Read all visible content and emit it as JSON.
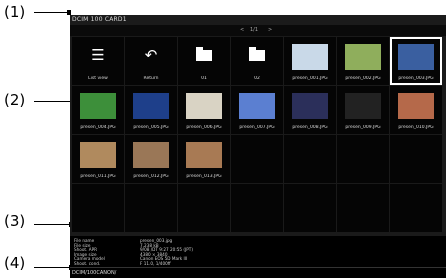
{
  "callouts": [
    "(1)",
    "(2)",
    "(3)",
    "(4)"
  ],
  "topbar": {
    "path": "DCIM  100  CARD1",
    "pager": {
      "prev": "<",
      "page": "1/1",
      "next": ">"
    }
  },
  "grid": {
    "items": [
      {
        "kind": "list",
        "icon": "list-icon",
        "label": "List view"
      },
      {
        "kind": "return",
        "icon": "return-icon",
        "label": "Return"
      },
      {
        "kind": "folder",
        "icon": "folder-icon",
        "label": "01"
      },
      {
        "kind": "folder",
        "icon": "folder-icon",
        "label": "02"
      },
      {
        "kind": "image",
        "label": "presen_001.JPG",
        "color": "#c9d9e8"
      },
      {
        "kind": "image",
        "label": "presen_002.JPG",
        "color": "#8fae5c"
      },
      {
        "kind": "image",
        "label": "presen_003.JPG",
        "color": "#3a5fa0",
        "selected": true
      },
      {
        "kind": "image",
        "label": "presen_004.JPG",
        "color": "#3d8f3a"
      },
      {
        "kind": "image",
        "label": "presen_005.JPG",
        "color": "#1e3f8a"
      },
      {
        "kind": "image",
        "label": "presen_006.JPG",
        "color": "#d9d3c4"
      },
      {
        "kind": "image",
        "label": "presen_007.JPG",
        "color": "#5b7fd1"
      },
      {
        "kind": "image",
        "label": "presen_008.JPG",
        "color": "#2b2f5a"
      },
      {
        "kind": "image",
        "label": "presen_009.JPG",
        "color": "#222222"
      },
      {
        "kind": "image",
        "label": "presen_010.JPG",
        "color": "#b5694a"
      },
      {
        "kind": "image",
        "label": "presen_011.JPG",
        "color": "#b08a5e"
      },
      {
        "kind": "image",
        "label": "presen_012.JPG",
        "color": "#9a7757"
      },
      {
        "kind": "image",
        "label": "presen_013.JPG",
        "color": "#a87a54"
      }
    ]
  },
  "info": {
    "rows": [
      {
        "key": "File name",
        "value": "presen_003.jpg"
      },
      {
        "key": "File size",
        "value": "7,238 kB"
      },
      {
        "key": "Shoot. APR",
        "value": "9/08 /DT  9:27 20:55 (JPT)"
      },
      {
        "key": "Image size",
        "value": "4380 × 3840"
      },
      {
        "key": "Camera model",
        "value": "Canon EOS 5D Mark III"
      },
      {
        "key": "Shoot. cond.",
        "value": "F 11.0, 1/400ff"
      }
    ]
  },
  "status": {
    "path": "DCIM/100CANON/"
  }
}
